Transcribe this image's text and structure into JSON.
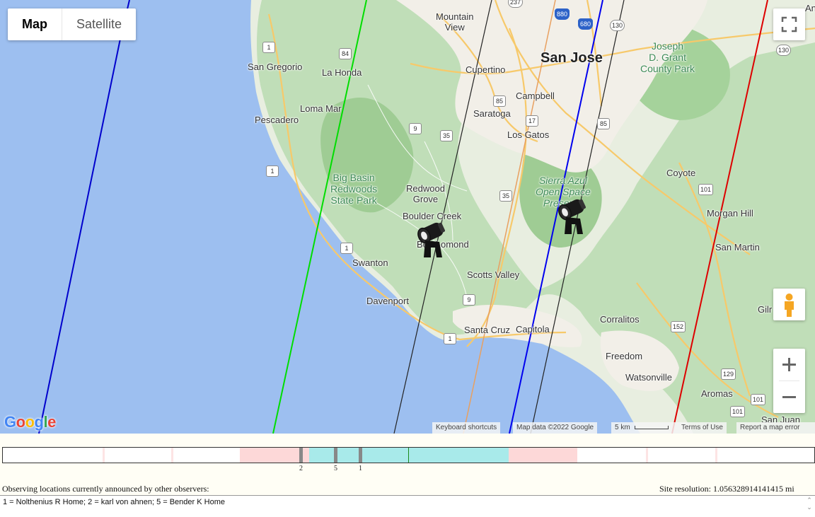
{
  "map": {
    "type_buttons": {
      "map": "Map",
      "satellite": "Satellite"
    },
    "cities": [
      {
        "name": "San Jose"
      }
    ],
    "places": [
      {
        "name": "Mountain\nView"
      },
      {
        "name": "San Gregorio"
      },
      {
        "name": "La Honda"
      },
      {
        "name": "Cupertino"
      },
      {
        "name": "Campbell"
      },
      {
        "name": "Saratoga"
      },
      {
        "name": "Loma Mar"
      },
      {
        "name": "Pescadero"
      },
      {
        "name": "Los Gatos"
      },
      {
        "name": "Redwood\nGrove"
      },
      {
        "name": "Boulder Creek"
      },
      {
        "name": "Ben Lomond"
      },
      {
        "name": "Swanton"
      },
      {
        "name": "Scotts Valley"
      },
      {
        "name": "Davenport"
      },
      {
        "name": "Santa Cruz"
      },
      {
        "name": "Capitola"
      },
      {
        "name": "Coyote"
      },
      {
        "name": "Morgan Hill"
      },
      {
        "name": "San Martin"
      },
      {
        "name": "Corralitos"
      },
      {
        "name": "Freedom"
      },
      {
        "name": "Watsonville"
      },
      {
        "name": "Aromas"
      },
      {
        "name": "San Juan"
      },
      {
        "name": "Gilr"
      },
      {
        "name": "An"
      }
    ],
    "parks": [
      {
        "name": "Joseph\nD. Grant\nCounty Park"
      },
      {
        "name": "Big Basin\nRedwoods\nState Park"
      },
      {
        "name": "Sierra Azul\nOpen Space\nPreserve"
      }
    ],
    "route_shields": [
      "237",
      "880",
      "680",
      "130",
      "1",
      "84",
      "85",
      "17",
      "9",
      "35",
      "85",
      "1",
      "101",
      "35",
      "9",
      "1",
      "1",
      "152",
      "129",
      "101",
      "101",
      "130"
    ],
    "icons": [
      "fullscreen-icon",
      "pegman-icon",
      "zoom-in-icon",
      "zoom-out-icon",
      "telescope-icon"
    ],
    "observers_on_map": 2,
    "footer": {
      "keyboard": "Keyboard shortcuts",
      "mapdata": "Map data ©2022 Google",
      "scale": "5 km",
      "terms": "Terms of Use",
      "report": "Report a map error"
    },
    "logo": "Google",
    "track_colors": [
      "#0000cc",
      "#00dd00",
      "#222222",
      "#e8a060",
      "#0000ee",
      "#222222",
      "#dd0000"
    ]
  },
  "timeline": {
    "tick_labels": [
      "2",
      "5",
      "1"
    ],
    "colors": {
      "pink": "#fdd8d8",
      "cyan": "#a8eaea",
      "tick": "#888888",
      "center": "#1a8a1a"
    }
  },
  "bottom": {
    "caption_left": "Observing locations currently announced by other observers:",
    "caption_right": "Site resolution: 1.056328914141415 mi",
    "observers_text": "1 = Nolthenius R Home; 2 = karl von ahnen; 5 = Bender K Home"
  }
}
